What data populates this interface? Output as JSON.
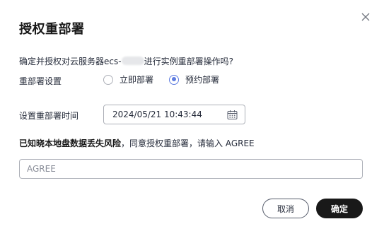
{
  "dialog": {
    "title": "授权重部署",
    "question_prefix": "确定并授权对云服务器ecs-",
    "question_suffix": "进行实例重部署操作吗?",
    "redeploy_setting": {
      "label": "重部署设置",
      "options": [
        {
          "label": "立即部署",
          "selected": false
        },
        {
          "label": "预约部署",
          "selected": true
        }
      ]
    },
    "schedule": {
      "label": "设置重部署时间",
      "value": "2024/05/21 10:43:44"
    },
    "confirm_text": {
      "bold": "已知晓本地盘数据丢失风险",
      "normal": "，同意授权重部署，请输入 AGREE"
    },
    "agree_input": {
      "placeholder": "AGREE",
      "value": ""
    },
    "buttons": {
      "cancel": "取消",
      "ok": "确定"
    },
    "accent_color": "#5e7ce0",
    "primary_button_color": "#191919",
    "icons": {
      "close": "close-icon",
      "calendar": "calendar-icon"
    }
  }
}
